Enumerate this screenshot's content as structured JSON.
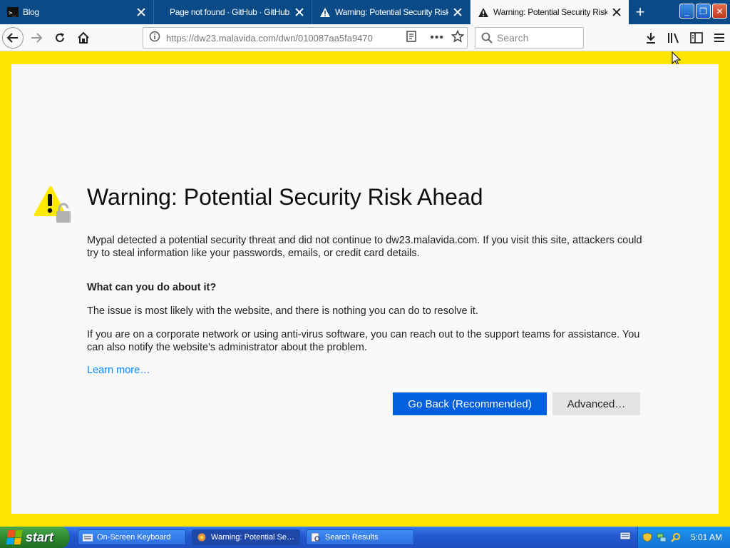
{
  "browser": {
    "tabs": [
      {
        "label": "Blog",
        "active": false
      },
      {
        "label": "Page not found · GitHub · GitHub",
        "active": false
      },
      {
        "label": "Warning: Potential Security Risk A",
        "active": false
      },
      {
        "label": "Warning: Potential Security Risk A",
        "active": true
      }
    ],
    "url": "https://dw23.malavida.com/dwn/010087aa5fa9470",
    "search_placeholder": "Search"
  },
  "page": {
    "title": "Warning: Potential Security Risk Ahead",
    "intro": "Mypal detected a potential security threat and did not continue to dw23.malavida.com. If you visit this site, attackers could try to steal information like your passwords, emails, or credit card details.",
    "heading": "What can you do about it?",
    "para1": "The issue is most likely with the website, and there is nothing you can do to resolve it.",
    "para2": "If you are on a corporate network or using anti-virus software, you can reach out to the support teams for assistance. You can also notify the website's administrator about the problem.",
    "learn_more": "Learn more…",
    "go_back": "Go Back (Recommended)",
    "advanced": "Advanced…"
  },
  "taskbar": {
    "start": "start",
    "tasks": [
      {
        "label": "On-Screen Keyboard",
        "active": false
      },
      {
        "label": "Warning: Potential Se…",
        "active": true
      },
      {
        "label": "Search Results",
        "active": false
      }
    ],
    "clock": "5:01 AM"
  },
  "colors": {
    "tabstrip": "#0a4a86",
    "page_border": "#ffe600",
    "primary_button": "#0060df",
    "link": "#0a84ff"
  }
}
